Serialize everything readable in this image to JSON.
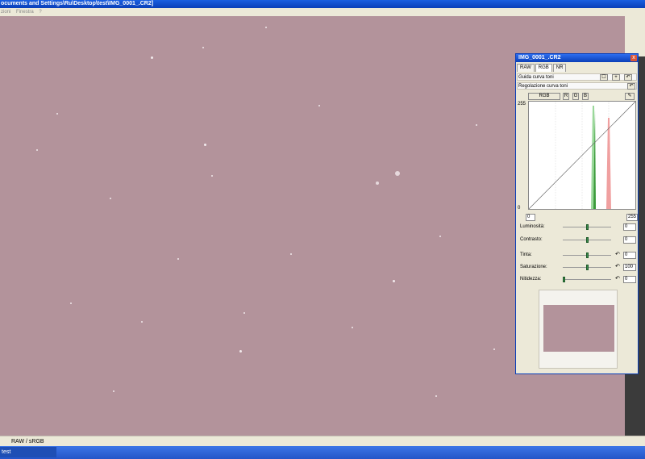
{
  "window": {
    "title": "ocuments and Settings\\Ru\\Desktop\\test\\IMG_0001_.CR2]",
    "menu": [
      "zioni",
      "Finestra",
      "?"
    ]
  },
  "status_bar": {
    "text": "RAW / sRGB"
  },
  "taskbar": {
    "item": "test"
  },
  "panel": {
    "title": "IMG_0001_.CR2",
    "close": "x",
    "tabs": [
      "RAW",
      "RGB",
      "NR"
    ],
    "active_tab": "RGB",
    "section1": "Guida curva toni",
    "section2": "Regolazione curva toni",
    "channels": [
      "RGB",
      "R",
      "G",
      "B"
    ],
    "curve": {
      "max_label": "255",
      "min_label": "0",
      "input_low": "0",
      "input_high": "255"
    },
    "sliders": [
      {
        "label": "Luminosità:",
        "value": "0",
        "level": 0.5,
        "reset": false
      },
      {
        "label": "Contrasto:",
        "value": "0",
        "level": 0.5,
        "reset": false
      },
      {
        "label": "Tinta:",
        "value": "0",
        "level": 0.5,
        "reset": true
      },
      {
        "label": "Saturazione:",
        "value": "100",
        "level": 0.5,
        "reset": true
      },
      {
        "label": "Nitidezza:",
        "value": "0",
        "level": 0.0,
        "reset": true
      }
    ]
  },
  "colors": {
    "image_bg": "#b3939b",
    "title_blue": "#0a3fb8",
    "panel_bg": "#ece9d8"
  }
}
